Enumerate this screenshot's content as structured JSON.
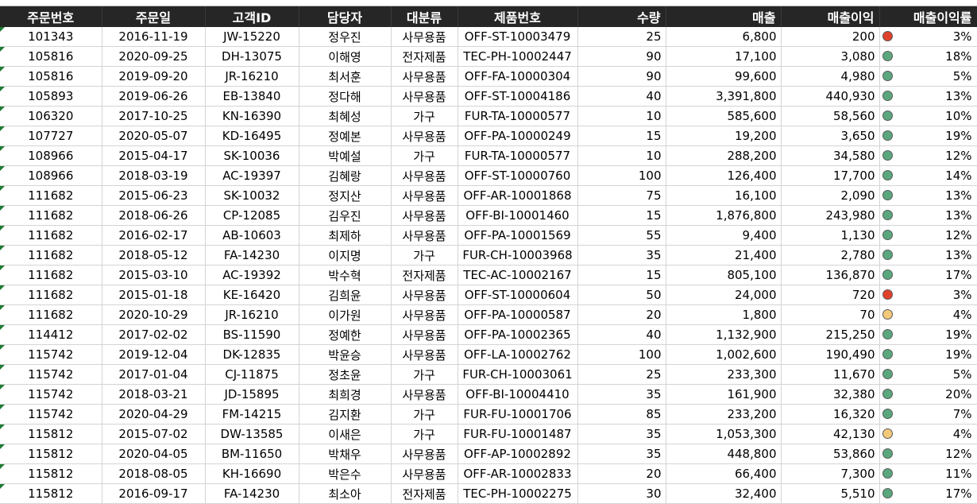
{
  "headers": [
    "주문번호",
    "주문일",
    "고객ID",
    "담당자",
    "대분류",
    "제품번호",
    "수량",
    "매출",
    "매출이익",
    "매출이익률"
  ],
  "status_colors": {
    "red": "#e0412a",
    "green": "#5aa77e",
    "yellow": "#f2c879"
  },
  "rows": [
    [
      "101343",
      "2016-11-19",
      "JW-15220",
      "정우진",
      "사무용품",
      "OFF-ST-10003479",
      "25",
      "6,800",
      "200",
      "3%",
      "red"
    ],
    [
      "105816",
      "2020-09-25",
      "DH-13075",
      "이해영",
      "전자제품",
      "TEC-PH-10002447",
      "90",
      "17,100",
      "3,080",
      "18%",
      "green"
    ],
    [
      "105816",
      "2019-09-20",
      "JR-16210",
      "최서훈",
      "사무용품",
      "OFF-FA-10000304",
      "90",
      "99,600",
      "4,980",
      "5%",
      "green"
    ],
    [
      "105893",
      "2019-06-26",
      "EB-13840",
      "정다해",
      "사무용품",
      "OFF-ST-10004186",
      "40",
      "3,391,800",
      "440,930",
      "13%",
      "green"
    ],
    [
      "106320",
      "2017-10-25",
      "KN-16390",
      "최혜성",
      "가구",
      "FUR-TA-10000577",
      "10",
      "585,600",
      "58,560",
      "10%",
      "green"
    ],
    [
      "107727",
      "2020-05-07",
      "KD-16495",
      "정예본",
      "사무용품",
      "OFF-PA-10000249",
      "15",
      "19,200",
      "3,650",
      "19%",
      "green"
    ],
    [
      "108966",
      "2015-04-17",
      "SK-10036",
      "박예설",
      "가구",
      "FUR-TA-10000577",
      "10",
      "288,200",
      "34,580",
      "12%",
      "green"
    ],
    [
      "108966",
      "2018-03-19",
      "AC-19397",
      "김혜랑",
      "사무용품",
      "OFF-ST-10000760",
      "100",
      "126,400",
      "17,700",
      "14%",
      "green"
    ],
    [
      "111682",
      "2015-06-23",
      "SK-10032",
      "정지산",
      "사무용품",
      "OFF-AR-10001868",
      "75",
      "16,100",
      "2,090",
      "13%",
      "green"
    ],
    [
      "111682",
      "2018-06-26",
      "CP-12085",
      "김우진",
      "사무용품",
      "OFF-BI-10001460",
      "15",
      "1,876,800",
      "243,980",
      "13%",
      "green"
    ],
    [
      "111682",
      "2016-02-17",
      "AB-10603",
      "최제하",
      "사무용품",
      "OFF-PA-10001569",
      "55",
      "9,400",
      "1,130",
      "12%",
      "green"
    ],
    [
      "111682",
      "2018-05-12",
      "FA-14230",
      "이지명",
      "가구",
      "FUR-CH-10003968",
      "35",
      "21,400",
      "2,780",
      "13%",
      "green"
    ],
    [
      "111682",
      "2015-03-10",
      "AC-19392",
      "박수혁",
      "전자제품",
      "TEC-AC-10002167",
      "15",
      "805,100",
      "136,870",
      "17%",
      "green"
    ],
    [
      "111682",
      "2015-01-18",
      "KE-16420",
      "김희윤",
      "사무용품",
      "OFF-ST-10000604",
      "50",
      "24,000",
      "720",
      "3%",
      "red"
    ],
    [
      "111682",
      "2020-10-29",
      "JR-16210",
      "이가원",
      "사무용품",
      "OFF-PA-10000587",
      "20",
      "1,800",
      "70",
      "4%",
      "yellow"
    ],
    [
      "114412",
      "2017-02-02",
      "BS-11590",
      "정예한",
      "사무용품",
      "OFF-PA-10002365",
      "40",
      "1,132,900",
      "215,250",
      "19%",
      "green"
    ],
    [
      "115742",
      "2019-12-04",
      "DK-12835",
      "박윤승",
      "사무용품",
      "OFF-LA-10002762",
      "100",
      "1,002,600",
      "190,490",
      "19%",
      "green"
    ],
    [
      "115742",
      "2017-01-04",
      "CJ-11875",
      "정초윤",
      "가구",
      "FUR-CH-10003061",
      "25",
      "233,300",
      "11,670",
      "5%",
      "green"
    ],
    [
      "115742",
      "2018-03-21",
      "JD-15895",
      "최희경",
      "사무용품",
      "OFF-BI-10004410",
      "35",
      "161,900",
      "32,380",
      "20%",
      "green"
    ],
    [
      "115742",
      "2020-04-29",
      "FM-14215",
      "김지환",
      "가구",
      "FUR-FU-10001706",
      "85",
      "233,200",
      "16,320",
      "7%",
      "green"
    ],
    [
      "115812",
      "2015-07-02",
      "DW-13585",
      "이새은",
      "가구",
      "FUR-FU-10001487",
      "35",
      "1,053,300",
      "42,130",
      "4%",
      "yellow"
    ],
    [
      "115812",
      "2020-04-05",
      "BM-11650",
      "박채우",
      "사무용품",
      "OFF-AP-10002892",
      "35",
      "448,800",
      "53,860",
      "12%",
      "green"
    ],
    [
      "115812",
      "2018-08-05",
      "KH-16690",
      "박은수",
      "사무용품",
      "OFF-AR-10002833",
      "20",
      "66,400",
      "7,300",
      "11%",
      "green"
    ],
    [
      "115812",
      "2016-09-17",
      "FA-14230",
      "최소아",
      "전자제품",
      "TEC-PH-10002275",
      "30",
      "32,400",
      "5,510",
      "17%",
      "green"
    ]
  ]
}
